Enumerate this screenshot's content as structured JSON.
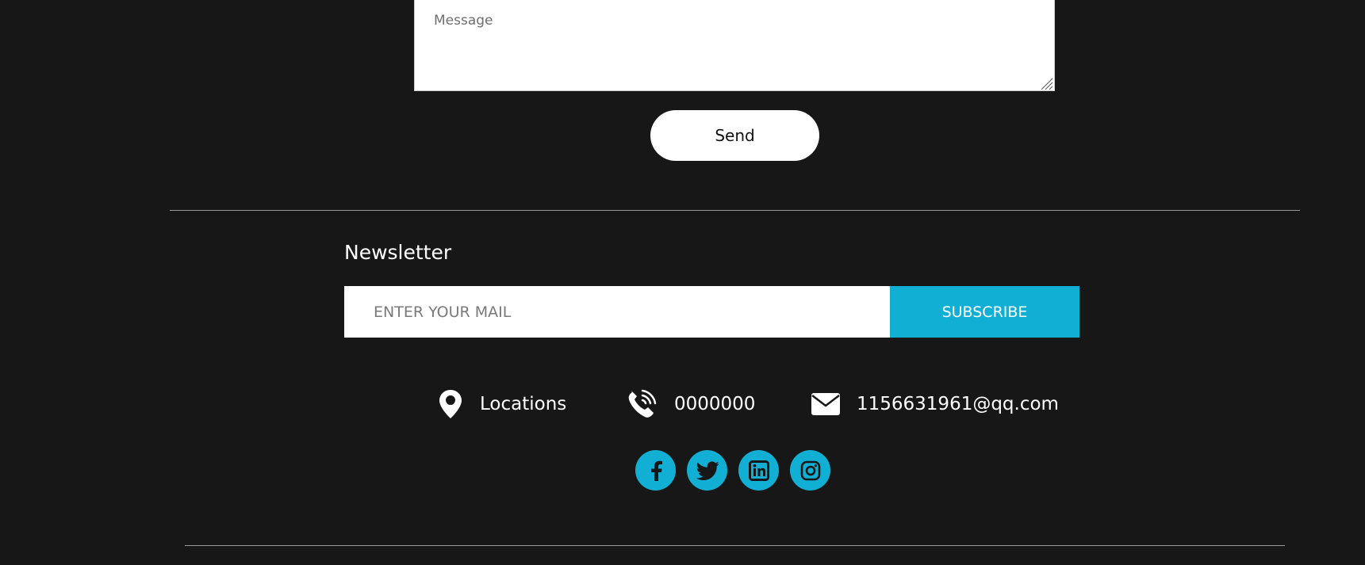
{
  "contact_form": {
    "message_placeholder": "Message",
    "message_value": "",
    "send_label": "Send"
  },
  "newsletter": {
    "title": "Newsletter",
    "mail_placeholder": "ENTER YOUR MAIL",
    "mail_value": "",
    "subscribe_label": "SUBSCRIBE"
  },
  "contact_info": {
    "location_label": "Locations",
    "phone_label": "0000000",
    "email_label": "1156631961@qq.com",
    "icons": [
      "map-pin-icon",
      "phone-icon",
      "envelope-icon"
    ]
  },
  "social": {
    "icons": [
      "facebook-icon",
      "twitter-icon",
      "linkedin-icon",
      "instagram-icon"
    ]
  },
  "colors": {
    "background": "#171717",
    "accent": "#12afd4",
    "text": "#ffffff"
  }
}
